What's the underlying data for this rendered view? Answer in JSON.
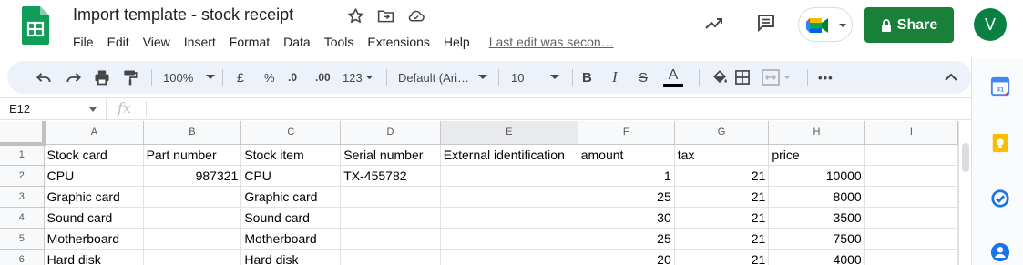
{
  "app": {
    "doc_title": "Import template - stock receipt",
    "last_edit": "Last edit was secon…",
    "share_label": "Share",
    "avatar_letter": "V"
  },
  "menu": [
    "File",
    "Edit",
    "View",
    "Insert",
    "Format",
    "Data",
    "Tools",
    "Extensions",
    "Help"
  ],
  "toolbar": {
    "zoom": "100%",
    "currency": "£",
    "percent": "%",
    "dec_decrease": ".0",
    "dec_increase": ".00",
    "number_format": "123",
    "font": "Default (Ari…",
    "font_size": "10",
    "bold": "B",
    "italic": "I",
    "strike": "S",
    "text_color": "A",
    "more": "•••"
  },
  "formula_bar": {
    "cell_ref": "E12",
    "fx": "fx"
  },
  "sheet": {
    "columns": [
      "A",
      "B",
      "C",
      "D",
      "E",
      "F",
      "G",
      "H",
      "I"
    ],
    "selected_column": "E",
    "rows": [
      {
        "n": "1",
        "cells": [
          "Stock card",
          "Part number",
          "Stock item",
          "Serial number",
          "External identification",
          "amount",
          "tax",
          "price",
          ""
        ]
      },
      {
        "n": "2",
        "cells": [
          "CPU",
          "987321",
          "CPU",
          "TX-455782",
          "",
          "1",
          "21",
          "10000",
          ""
        ]
      },
      {
        "n": "3",
        "cells": [
          "Graphic card",
          "",
          "Graphic card",
          "",
          "",
          "25",
          "21",
          "8000",
          ""
        ]
      },
      {
        "n": "4",
        "cells": [
          "Sound card",
          "",
          "Sound card",
          "",
          "",
          "30",
          "21",
          "3500",
          ""
        ]
      },
      {
        "n": "5",
        "cells": [
          "Motherboard",
          "",
          "Motherboard",
          "",
          "",
          "25",
          "21",
          "7500",
          ""
        ]
      },
      {
        "n": "6",
        "cells": [
          "Hard disk",
          "",
          "Hard disk",
          "",
          "",
          "20",
          "21",
          "4000",
          ""
        ]
      }
    ]
  },
  "side_panel": [
    "calendar-icon",
    "keep-icon",
    "tasks-icon",
    "contacts-icon"
  ],
  "colors": {
    "share_green": "#188038",
    "sheets_green": "#0f9d58",
    "toolbar_bg": "#edf2fa",
    "header_bg": "#f8f9fa"
  }
}
